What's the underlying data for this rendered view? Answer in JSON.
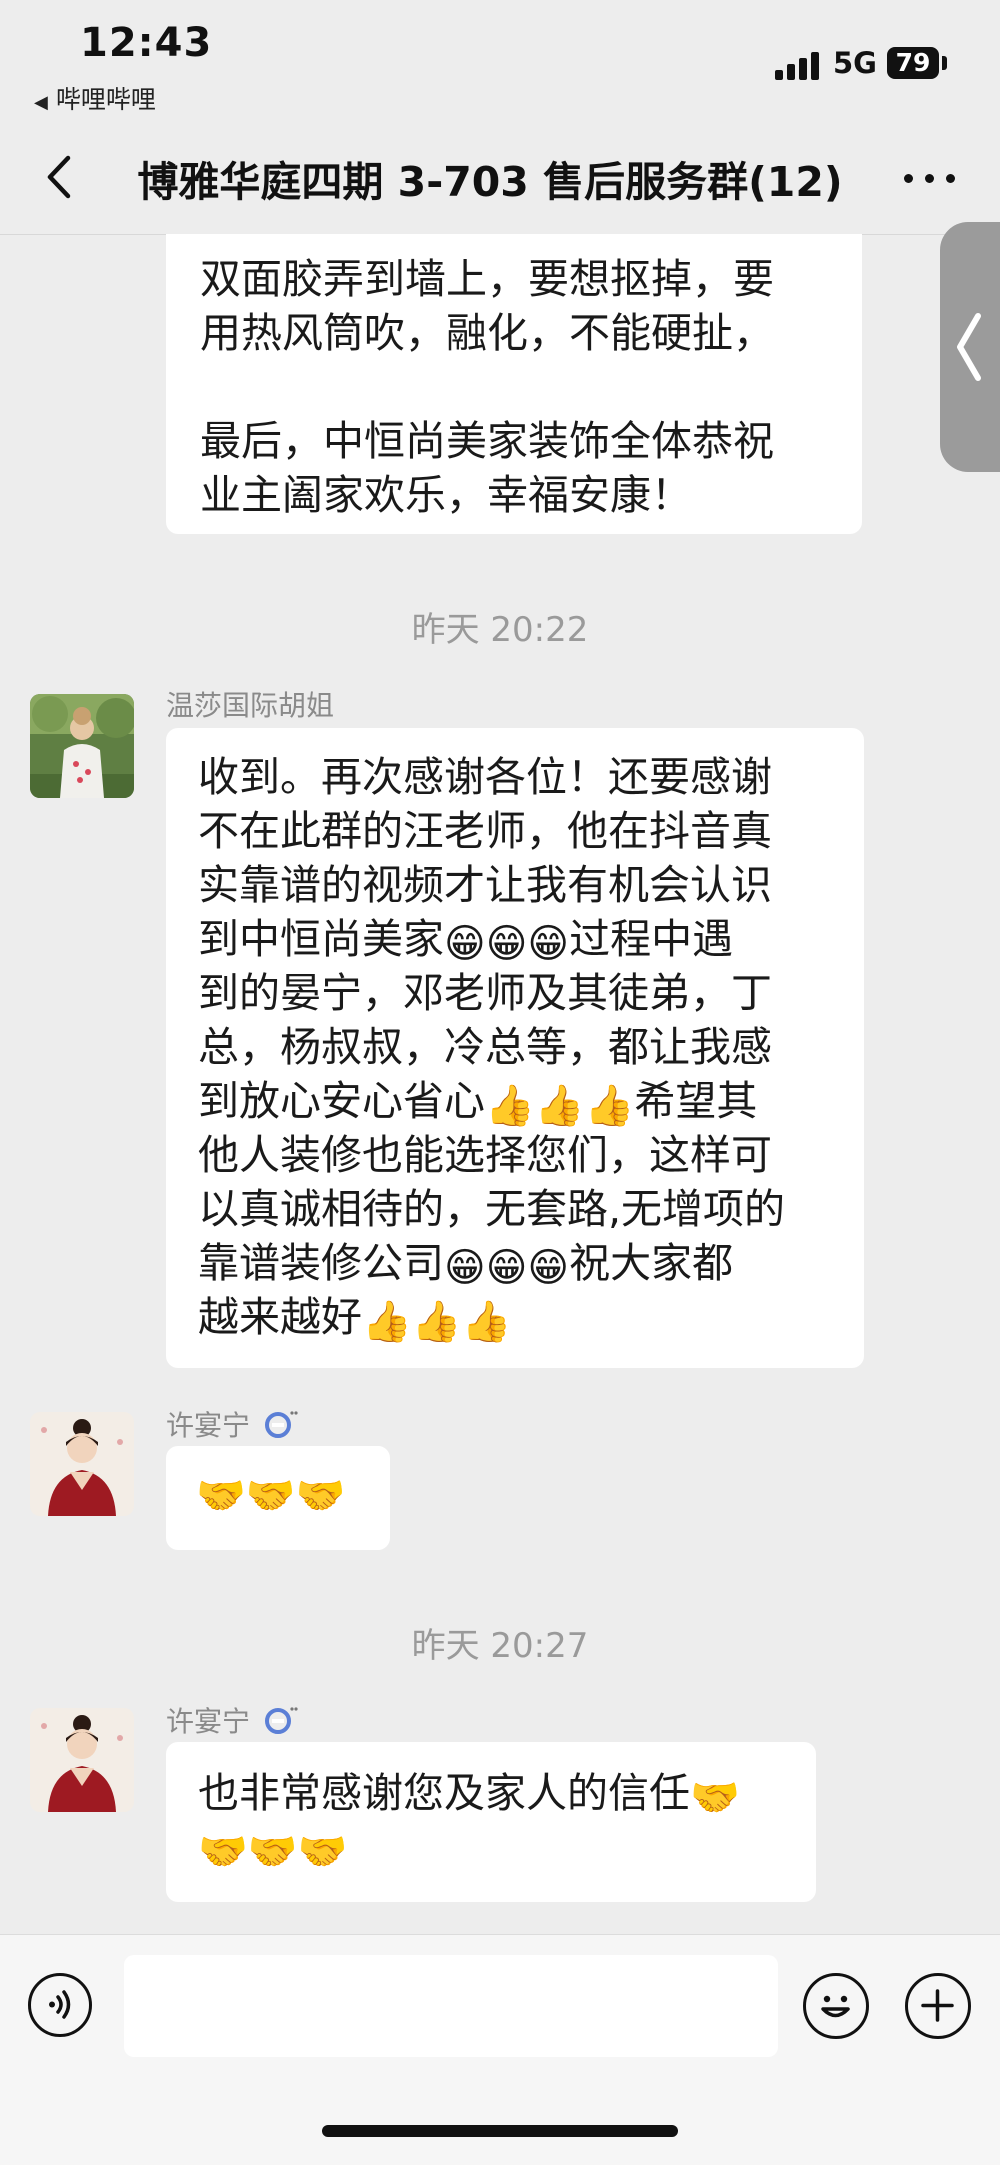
{
  "status_bar": {
    "time": "12:43",
    "back_app": "哔哩哔哩",
    "network": "5G",
    "battery": "79"
  },
  "nav": {
    "title": "博雅华庭四期 3-703 售后服务群(12)"
  },
  "messages": [
    {
      "lines": [
        "双面胶弄到墙上，要想抠掉，要",
        "用热风筒吹，融化，不能硬扯，",
        "",
        "最后，中恒尚美家装饰全体恭祝",
        "业主阖家欢乐，幸福安康！"
      ]
    },
    {
      "timestamp": "昨天 20:22"
    },
    {
      "sender": "温莎国际胡姐",
      "lines": [
        "收到。再次感谢各位！还要感谢",
        "不在此群的汪老师，他在抖音真",
        "实靠谱的视频才让我有机会认识",
        [
          "到中恒尚美家",
          "😁😁😁",
          "过程中遇"
        ],
        "到的晏宁，邓老师及其徒弟，丁",
        "总，杨叔叔，冷总等，都让我感",
        [
          "到放心安心省心",
          "👍👍👍",
          "希望其"
        ],
        "他人装修也能选择您们，这样可",
        "以真诚相待的，无套路,无增项的",
        [
          "靠谱装修公司",
          "😁😁😁",
          "祝大家都"
        ],
        [
          "越来越好",
          "👍👍👍",
          ""
        ]
      ]
    },
    {
      "sender": "许宴宁",
      "emoji": "🤝🤝🤝"
    },
    {
      "timestamp": "昨天 20:27"
    },
    {
      "sender": "许宴宁",
      "lines": [
        [
          "也非常感谢您及家人的信任",
          "🤝",
          ""
        ],
        [
          "",
          "🤝🤝🤝",
          ""
        ]
      ]
    }
  ],
  "icons": {
    "back": "chevron-left-icon",
    "more": "more-dots-icon",
    "voice": "voice-icon",
    "emoji": "emoji-face-icon",
    "plus": "plus-icon"
  }
}
